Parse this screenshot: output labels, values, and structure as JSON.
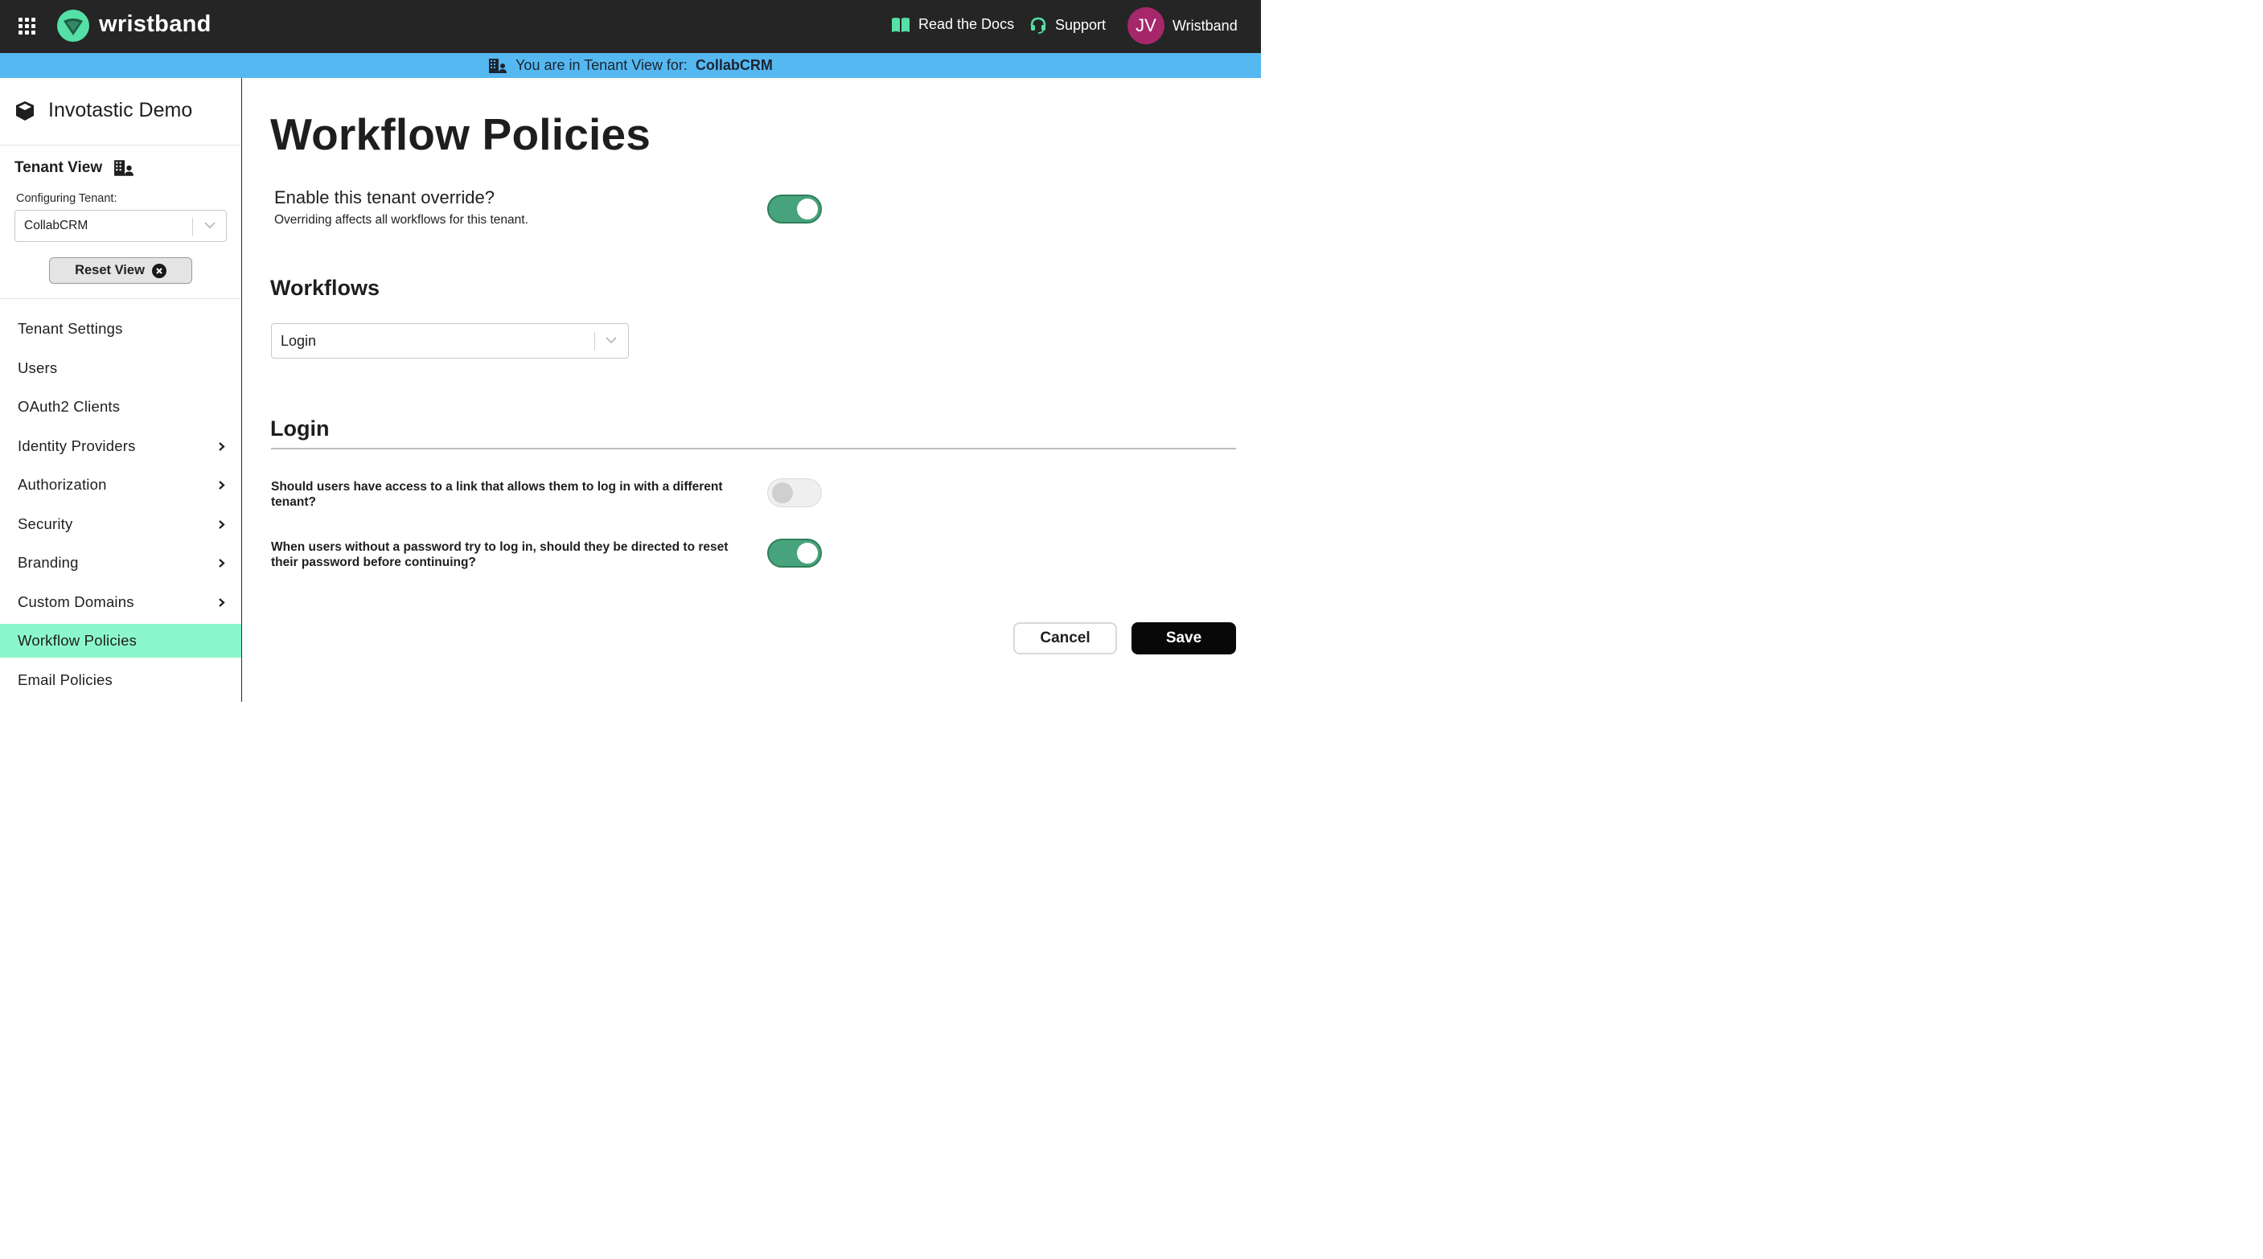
{
  "topbar": {
    "brand": "wristband",
    "docs_label": "Read the Docs",
    "support_label": "Support",
    "user_initials": "JV",
    "user_name": "Wristband",
    "avatar_color": "#a6286a",
    "logo_color": "#55e0a6"
  },
  "banner": {
    "prefix": "You are in Tenant View for:",
    "tenant": "CollabCRM",
    "color": "#55b8f1"
  },
  "sidebar": {
    "app_name": "Invotastic Demo",
    "tenant_view_title": "Tenant View",
    "config_label": "Configuring Tenant:",
    "tenant_value": "CollabCRM",
    "reset_label": "Reset View",
    "active_color": "#8cf7cb",
    "items": [
      {
        "label": "Tenant Settings",
        "has_children": false
      },
      {
        "label": "Users",
        "has_children": false
      },
      {
        "label": "OAuth2 Clients",
        "has_children": false
      },
      {
        "label": "Identity Providers",
        "has_children": true
      },
      {
        "label": "Authorization",
        "has_children": true
      },
      {
        "label": "Security",
        "has_children": true
      },
      {
        "label": "Branding",
        "has_children": true
      },
      {
        "label": "Custom Domains",
        "has_children": true
      },
      {
        "label": "Workflow Policies",
        "has_children": false,
        "active": true
      },
      {
        "label": "Email Policies",
        "has_children": false
      }
    ]
  },
  "main": {
    "title": "Workflow Policies",
    "override_question": "Enable this tenant override?",
    "override_help": "Overriding affects all workflows for this tenant.",
    "override_enabled": true,
    "workflows_heading": "Workflows",
    "workflow_selected": "Login",
    "login_heading": "Login",
    "questions": [
      {
        "text": "Should users have access to a link that allows them to log in with a different tenant?",
        "enabled": false
      },
      {
        "text": "When users without a password try to log in, should they be directed to reset their password before continuing?",
        "enabled": true
      }
    ],
    "toggle_on_color": "#47a37b",
    "cancel_label": "Cancel",
    "save_label": "Save"
  }
}
